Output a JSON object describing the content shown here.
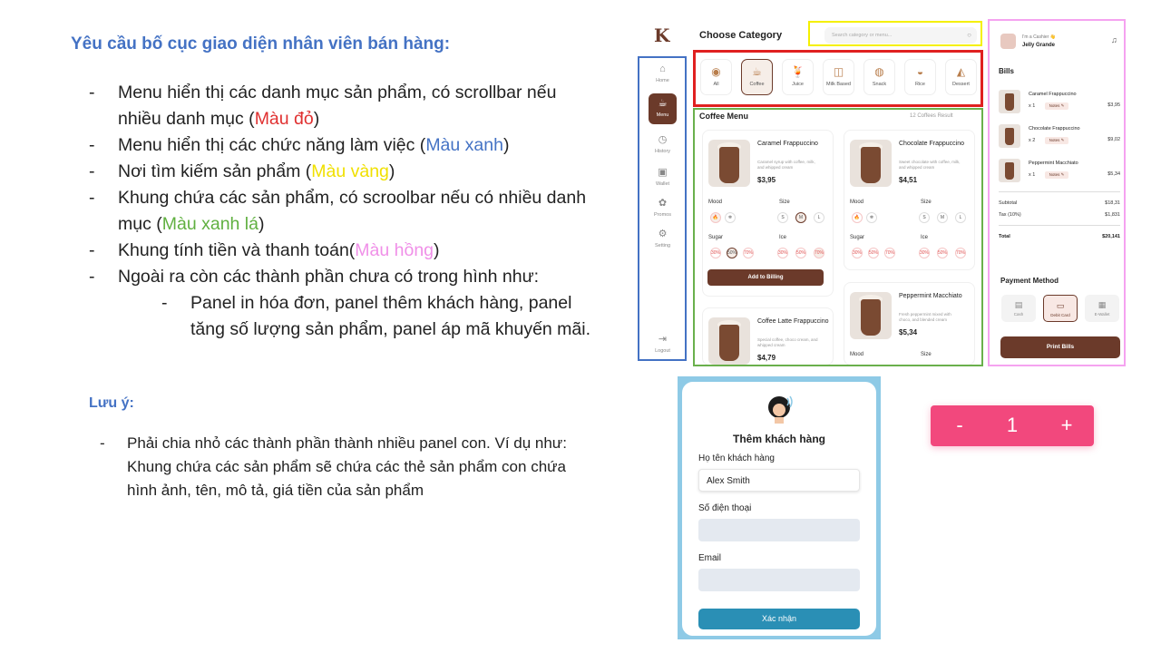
{
  "requirements": {
    "title": "Yêu cầu bố cục giao diện nhân viên bán hàng:",
    "items": [
      {
        "text": "Menu hiển thị các danh mục sản phẩm, có scrollbar nếu nhiều danh mục (",
        "color_label": "Màu đỏ",
        "after": ")"
      },
      {
        "text": "Menu hiển thị các chức năng làm việc (",
        "color_label": "Màu xanh",
        "after": ")"
      },
      {
        "text": "Nơi tìm kiếm sản phẩm (",
        "color_label": "Màu vàng",
        "after": ")"
      },
      {
        "text": "Khung chứa các sản phẩm, có scroolbar nếu có nhiều danh mục (",
        "color_label": "Màu xanh lá",
        "after": ")"
      },
      {
        "text": "Khung tính tiền và thanh toán(",
        "color_label": "Màu hồng",
        "after": ")"
      },
      {
        "text": "Ngoài ra còn các thành phần chưa có trong hình như:"
      }
    ],
    "sub_item": "Panel in hóa đơn, panel thêm khách hàng, panel tăng số lượng sản phẩm, panel áp mã khuyến mãi.",
    "dash": "-"
  },
  "note": {
    "title": "Lưu ý:",
    "text": "Phải chia nhỏ các thành phần thành nhiều panel con. Ví dụ như: Khung chứa các sản phẩm sẽ chứa các thẻ sản phẩm con chứa hình ảnh, tên, mô tả, giá tiền của sản phẩm"
  },
  "pos": {
    "logo": "K",
    "nav": [
      {
        "label": "Home",
        "icon": "home-icon",
        "glyph": "⌂"
      },
      {
        "label": "Menu",
        "icon": "menu-icon",
        "glyph": "☕"
      },
      {
        "label": "History",
        "icon": "history-icon",
        "glyph": "◷"
      },
      {
        "label": "Wallet",
        "icon": "wallet-icon",
        "glyph": "▣"
      },
      {
        "label": "Promos",
        "icon": "promos-icon",
        "glyph": "✿"
      },
      {
        "label": "Setting",
        "icon": "gear-icon",
        "glyph": "⚙"
      },
      {
        "label": "Logout",
        "icon": "logout-icon",
        "glyph": "⇥"
      }
    ],
    "category_title": "Choose Category",
    "search_placeholder": "Search category or menu...",
    "categories": [
      {
        "label": "All",
        "glyph": "◉"
      },
      {
        "label": "Coffee",
        "glyph": "☕"
      },
      {
        "label": "Juice",
        "glyph": "🍹"
      },
      {
        "label": "Milk Based",
        "glyph": "◫"
      },
      {
        "label": "Snack",
        "glyph": "◍"
      },
      {
        "label": "Rice",
        "glyph": "◒"
      },
      {
        "label": "Dessert",
        "glyph": "◭"
      }
    ],
    "menu_title": "Coffee Menu",
    "menu_count": "12 Coffees Result",
    "products": [
      {
        "name": "Caramel Frappuccino",
        "desc": "Caramel syrup with coffee, milk, and whipped cream",
        "price": "$3,95"
      },
      {
        "name": "Chocolate Frappuccino",
        "desc": "Sweet chocolate with coffee, milk, and whipped cream",
        "price": "$4,51"
      },
      {
        "name": "Coffee Latte Frappuccino",
        "desc": "Special coffee, choco cream, and whipped cream",
        "price": "$4,79"
      },
      {
        "name": "Peppermint Macchiato",
        "desc": "Fresh peppermint mixed with choco, and blended cream",
        "price": "$5,34"
      }
    ],
    "labels": {
      "mood": "Mood",
      "size": "Size",
      "sugar": "Sugar",
      "ice": "Ice"
    },
    "sizes": [
      "S",
      "M",
      "L"
    ],
    "levels": [
      "30%",
      "50%",
      "70%"
    ],
    "add_button": "Add to Billing",
    "cashier": {
      "role": "I'm a Cashier 👋",
      "name": "Jelly Grande"
    },
    "bills_title": "Bills",
    "bills": [
      {
        "name": "Caramel Frappuccino",
        "qty": "x 1",
        "notes": "Notes ✎",
        "price": "$3,95"
      },
      {
        "name": "Chocolate Frappuccino",
        "qty": "x 2",
        "notes": "Notes ✎",
        "price": "$9,02"
      },
      {
        "name": "Peppermint Macchiato",
        "qty": "x 1",
        "notes": "Notes ✎",
        "price": "$5,34"
      }
    ],
    "subtotal_label": "Subtotal",
    "subtotal": "$18,31",
    "tax_label": "Tax (10%)",
    "tax": "$1,831",
    "total_label": "Total",
    "total": "$20,141",
    "payment_title": "Payment Method",
    "payments": [
      {
        "label": "Cash",
        "glyph": "▤"
      },
      {
        "label": "Debit Card",
        "glyph": "▭"
      },
      {
        "label": "E-Wallet",
        "glyph": "▦"
      }
    ],
    "print_button": "Print Bills"
  },
  "customer": {
    "title": "Thêm khách hàng",
    "name_label": "Họ tên khách hàng",
    "name_value": "Alex Smith",
    "phone_label": "Số điện thoại",
    "phone_value": "",
    "email_label": "Email",
    "email_value": "",
    "confirm": "Xác nhận"
  },
  "stepper": {
    "minus": "-",
    "value": "1",
    "plus": "+"
  },
  "colors": {
    "blue_frame": "#4472c4",
    "yellow_frame": "#f5f000",
    "red_frame": "#e02020",
    "green_frame": "#6ab04c",
    "pink_frame": "#f5a3f0",
    "brown": "#6b3a2a",
    "stepper": "#f2487d",
    "confirm": "#2a8fb5"
  }
}
